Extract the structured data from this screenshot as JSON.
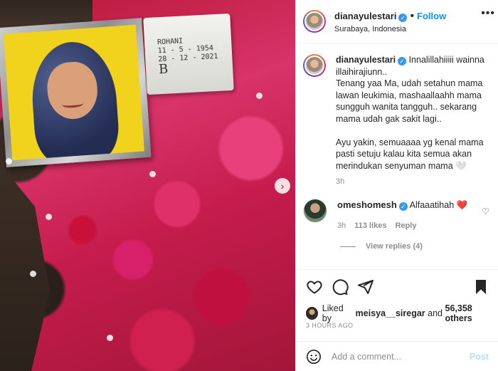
{
  "photo": {
    "tomb_lines": [
      "ROHANI",
      "11 - 5 - 1954",
      "28 - 12 - 2021",
      "B"
    ]
  },
  "post": {
    "username": "dianayulestari",
    "follow_label": "Follow",
    "location": "Surabaya, Indonesia",
    "caption_text": "Innalillahiiiii wainna illaihirajiunn..\nTenang yaa Ma, udah setahun mama lawan leukimia, mashaallaahh mama sungguh wanita tangguh.. sekarang mama udah gak sakit lagi..\n\nAyu yakin, semuaaaa yg kenal mama pasti setuju kalau kita semua akan merindukan senyuman mama 🤍",
    "caption_time": "3h"
  },
  "comment": {
    "username": "omeshomesh",
    "text": "Alfaaatihah ❤️",
    "time": "3h",
    "likes": "113 likes",
    "reply_label": "Reply",
    "view_replies": "View replies (4)"
  },
  "likes": {
    "prefix": "Liked by",
    "user": "meisya__siregar",
    "middle": "and",
    "count": "56,358 others"
  },
  "timestamp": "3 HOURS AGO",
  "add_comment": {
    "placeholder": "Add a comment...",
    "post_label": "Post"
  },
  "colors": {
    "accent": "#0095f6",
    "verified": "#3897f0",
    "muted": "#8e8e8e"
  }
}
